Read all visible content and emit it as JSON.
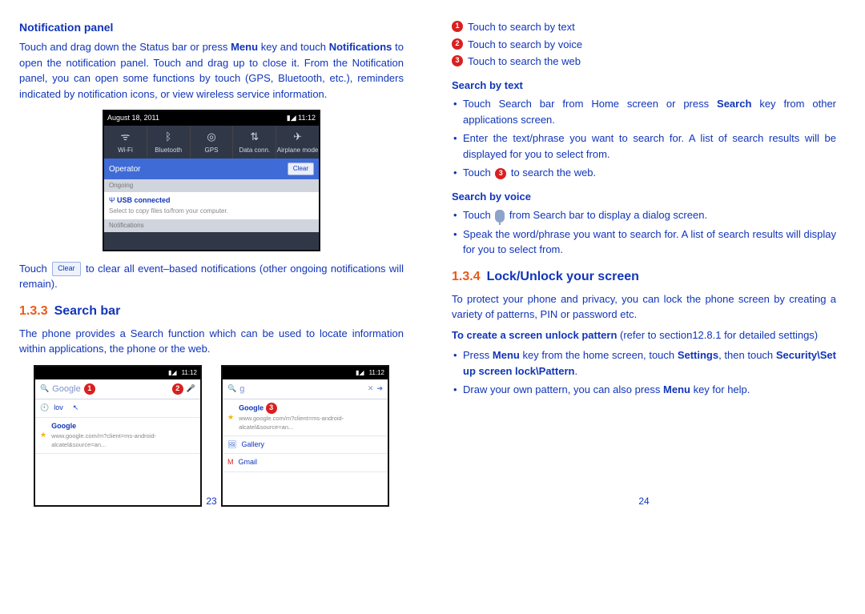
{
  "left": {
    "notif_title": "Notification panel",
    "notif_p1a": "Touch and drag down the Status bar or press ",
    "notif_p1_menu": "Menu",
    "notif_p1b": " key and touch ",
    "notif_p1_notifs": "Notifications",
    "notif_p1c": " to open the notification panel. Touch and drag up to close it. From the Notification panel, you can open some functions by touch (GPS, Bluetooth, etc.), reminders indicated by notification icons, or view wireless service information.",
    "touch_a": "Touch ",
    "clear_chip": "Clear",
    "touch_b": " to clear all event–based notifications (other ongoing notifications will remain).",
    "sec_num_133": "1.3.3",
    "sec_title_133": "Search bar",
    "search_p": "The phone provides a Search function which can be used to locate information within applications, the phone or the web.",
    "pagenum": "23"
  },
  "phone_notif": {
    "date": "August 18, 2011",
    "time": "11:12",
    "toggles": [
      "Wi-Fi",
      "Bluetooth",
      "GPS",
      "Data conn.",
      "Airplane mode"
    ],
    "operator": "Operator",
    "clear": "Clear",
    "ongoing": "Ongoing",
    "usb_t": "USB connected",
    "usb_s": "Select to copy files to/from your computer.",
    "notifications": "Notifications"
  },
  "phone_search1": {
    "time": "11:12",
    "brand": "Google",
    "row1": "lov",
    "row2_t": "Google",
    "row2_s": "www.google.com/m?client=ms-android-alcatel&source=an..."
  },
  "phone_search2": {
    "time": "11:12",
    "brand": "g",
    "row1_t": "Google",
    "row1_s": "www.google.com/m?client=ms-android-alcatel&source=an...",
    "row2": "Gallery",
    "row3": "Gmail"
  },
  "right": {
    "callouts": {
      "c1": "Touch to search by text",
      "c2": "Touch to search by voice",
      "c3": "Touch to search the web"
    },
    "sbt_head": "Search by text",
    "sbt_b1a": "Touch Search bar from Home screen or press ",
    "sbt_b1_search": "Search",
    "sbt_b1b": " key from other applications screen.",
    "sbt_b2": "Enter the text/phrase you want to search for.  A list of search results will be displayed for you to select from.",
    "sbt_b3a": "Touch ",
    "sbt_b3b": " to search the web.",
    "sbv_head": "Search by voice",
    "sbv_b1a": "Touch ",
    "sbv_b1b": " from Search bar to display a dialog screen.",
    "sbv_b2": "Speak the word/phrase you want to search for.  A list of search results will display for you to select from.",
    "sec_num_134": "1.3.4",
    "sec_title_134": "Lock/Unlock your screen",
    "lock_p": "To protect your phone and privacy, you can lock the phone screen by creating a variety of patterns, PIN or password etc.",
    "create_a": "To create a screen unlock pattern",
    "create_b": " (refer to section12.8.1 for detailed settings)",
    "lock_b1a": "Press ",
    "lock_b1_menu": "Menu",
    "lock_b1b": " key from the home screen, touch ",
    "lock_b1_settings": "Settings",
    "lock_b1c": ", then touch ",
    "lock_b1_path": "Security\\Set up screen lock\\Pattern",
    "lock_b1d": ".",
    "lock_b2a": "Draw your own pattern, you can also press ",
    "lock_b2_menu": "Menu",
    "lock_b2b": " key for help.",
    "pagenum": "24"
  }
}
